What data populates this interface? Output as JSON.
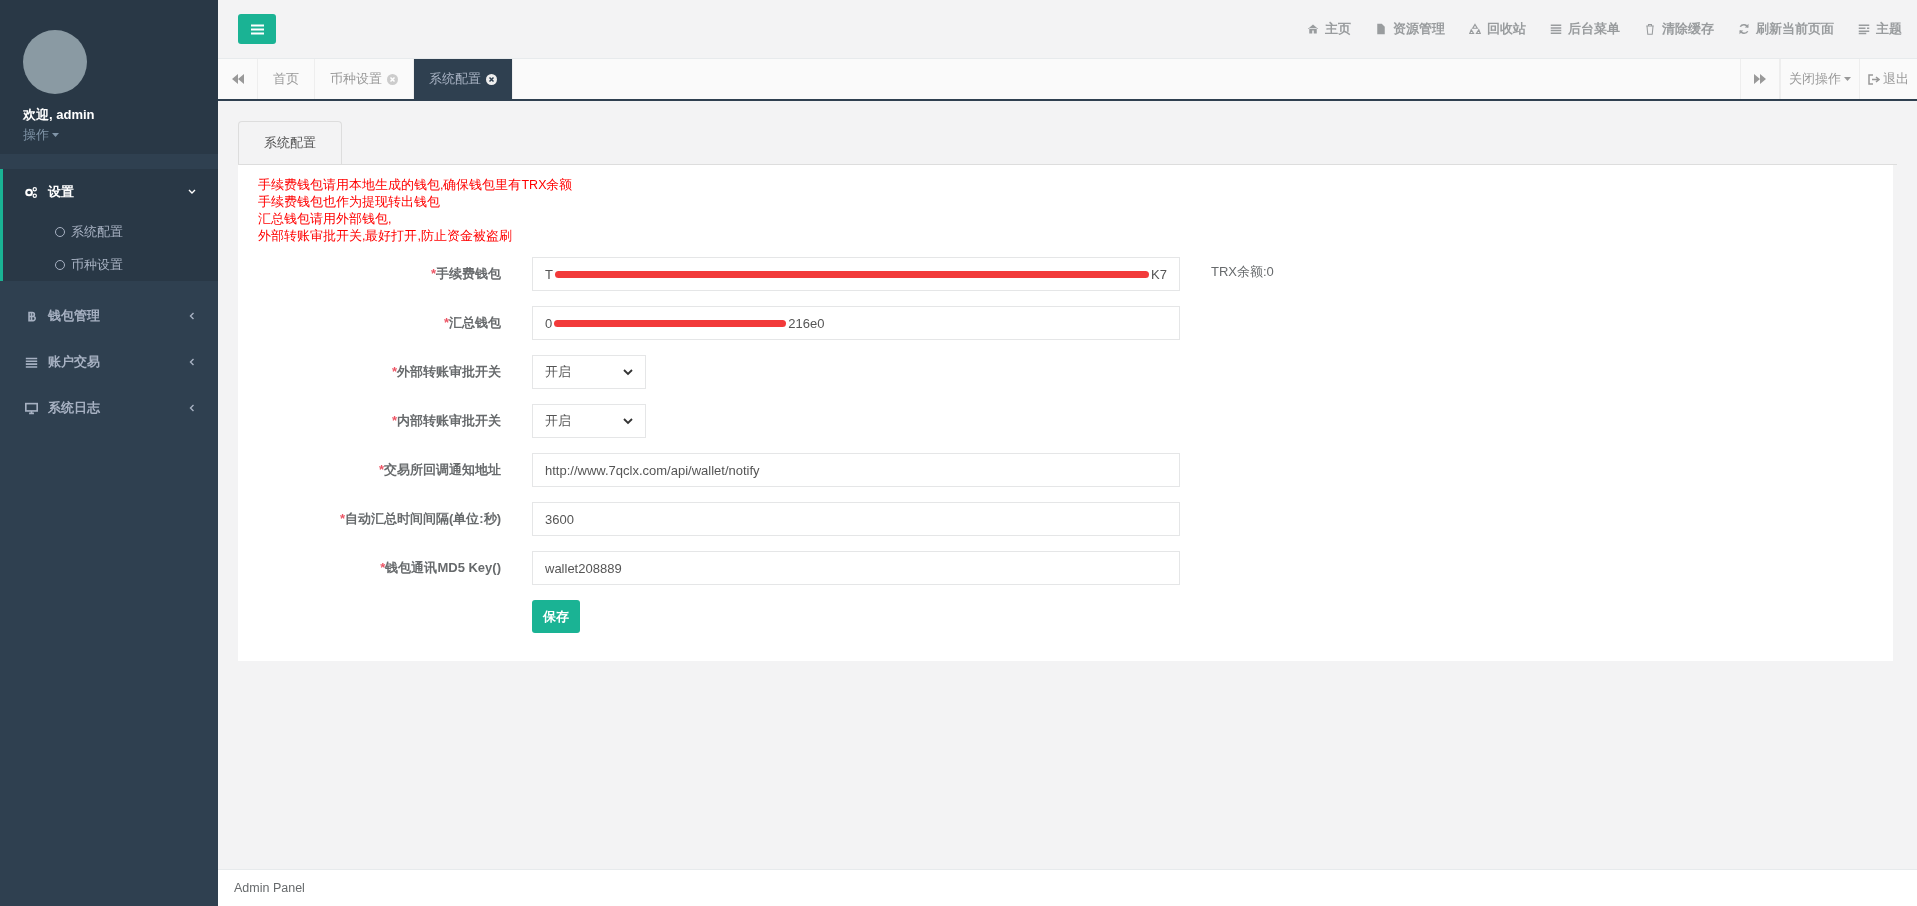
{
  "sidebar": {
    "profile": {
      "welcome": "欢迎, admin",
      "menu": "操作"
    },
    "items": [
      {
        "label": "设置",
        "expanded": true,
        "selected": true,
        "children": [
          {
            "label": "系统配置"
          },
          {
            "label": "币种设置"
          }
        ]
      },
      {
        "label": "钱包管理",
        "expanded": false,
        "selected": false
      },
      {
        "label": "账户交易",
        "expanded": false,
        "selected": false
      },
      {
        "label": "系统日志",
        "expanded": false,
        "selected": false
      }
    ]
  },
  "top_nav": [
    {
      "label": "主页"
    },
    {
      "label": "资源管理"
    },
    {
      "label": "回收站"
    },
    {
      "label": "后台菜单"
    },
    {
      "label": "清除缓存"
    },
    {
      "label": "刷新当前页面"
    },
    {
      "label": "主题"
    }
  ],
  "tabs": [
    {
      "label": "首页",
      "selected": false,
      "closable": false
    },
    {
      "label": "币种设置",
      "selected": false,
      "closable": true
    },
    {
      "label": "系统配置",
      "selected": true,
      "closable": true
    }
  ],
  "tab_actions": {
    "close_menu": "关闭操作",
    "logout": "退出"
  },
  "panel": {
    "tab": "系统配置",
    "hints": [
      "手续费钱包请用本地生成的钱包,确保钱包里有TRX余额",
      "手续费钱包也作为提现转出钱包",
      "汇总钱包请用外部钱包,",
      "外部转账审批开关,最好打开,防止资金被盗刷"
    ],
    "fields": [
      {
        "kind": "redacted",
        "required_mark": "*",
        "label": "手续费钱包",
        "value_start": "T",
        "value_end": "K7",
        "note": "TRX余额:0"
      },
      {
        "kind": "redacted",
        "required_mark": "*",
        "label": "汇总钱包",
        "value_start": "0",
        "value_end": "216e0"
      },
      {
        "kind": "select",
        "required_mark": "*",
        "label": "外部转账审批开关",
        "value": "开启"
      },
      {
        "kind": "select",
        "required_mark": "*",
        "label": "内部转账审批开关",
        "value": "开启"
      },
      {
        "kind": "text",
        "required_mark": "*",
        "label": "交易所回调通知地址",
        "value": "http://www.7qclx.com/api/wallet/notify"
      },
      {
        "kind": "text",
        "required_mark": "*",
        "label": "自动汇总时间间隔(单位:秒)",
        "value": "3600"
      },
      {
        "kind": "text",
        "required_mark": "*",
        "label": "钱包通讯MD5 Key()",
        "value": "wallet208889"
      }
    ],
    "save": "保存"
  },
  "footer": "Admin Panel"
}
